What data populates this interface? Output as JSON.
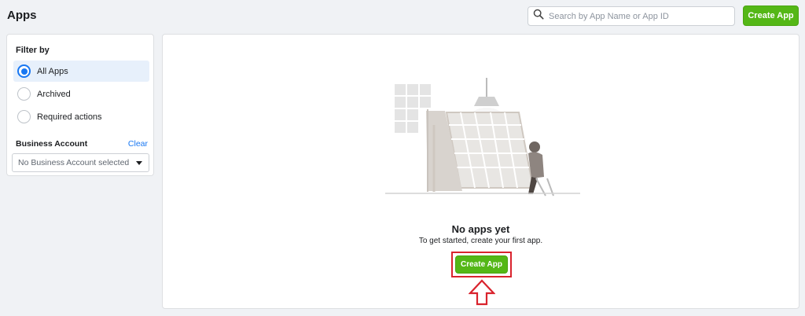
{
  "header": {
    "title": "Apps",
    "search_placeholder": "Search by App Name or App ID",
    "create_label": "Create App"
  },
  "filter": {
    "heading": "Filter by",
    "options": [
      {
        "label": "All Apps",
        "selected": true
      },
      {
        "label": "Archived",
        "selected": false
      },
      {
        "label": "Required actions",
        "selected": false
      }
    ],
    "business_label": "Business Account",
    "clear_label": "Clear",
    "business_select_value": "No Business Account selected"
  },
  "main": {
    "empty_title": "No apps yet",
    "empty_subtitle": "To get started, create your first app.",
    "create_label": "Create App"
  },
  "colors": {
    "accent_green": "#54b716",
    "selection_blue": "#1877f2",
    "annotation_red": "#d9232d"
  },
  "icons": {
    "search": "search-icon",
    "dropdown": "caret-down-icon",
    "annotation": "up-arrow-icon"
  }
}
